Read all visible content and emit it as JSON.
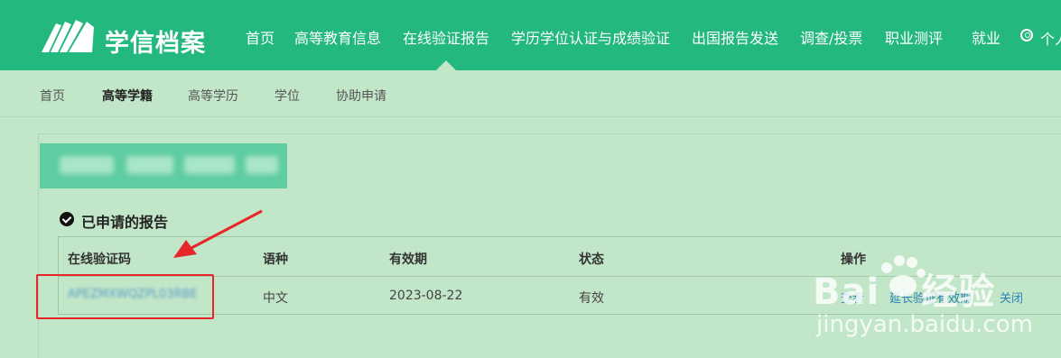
{
  "header": {
    "brand": "学信档案",
    "nav": [
      {
        "label": "首页",
        "active": false
      },
      {
        "label": "高等教育信息",
        "active": false
      },
      {
        "label": "在线验证报告",
        "active": true
      },
      {
        "label": "学历学位认证与成绩验证",
        "active": false
      },
      {
        "label": "出国报告发送",
        "active": false
      },
      {
        "label": "调查/投票",
        "active": false
      },
      {
        "label": "职业测评",
        "active": false
      },
      {
        "label": "就业",
        "active": false
      }
    ],
    "user_label": "个人"
  },
  "subnav": [
    {
      "label": "首页",
      "active": false
    },
    {
      "label": "高等学籍",
      "active": true
    },
    {
      "label": "高等学历",
      "active": false
    },
    {
      "label": "学位",
      "active": false
    },
    {
      "label": "协助申请",
      "active": false
    }
  ],
  "section": {
    "title": "已申请的报告"
  },
  "table": {
    "columns": [
      "在线验证码",
      "语种",
      "有效期",
      "状态",
      "操作"
    ],
    "rows": [
      {
        "code": "APEZMXWQZPL03RBE",
        "language": "中文",
        "expiry": "2023-08-22",
        "status": "有效",
        "actions": [
          "查看",
          "延长验证有效期",
          "关闭"
        ]
      }
    ]
  },
  "watermark": {
    "brand": "Bai",
    "brand_cn": "经验",
    "url": "jingyan.baidu.com"
  },
  "colors": {
    "header_bg": "#22b87e",
    "page_bg": "#c2e6c8",
    "link": "#2c7fb8",
    "annotation": "#e8262a"
  }
}
